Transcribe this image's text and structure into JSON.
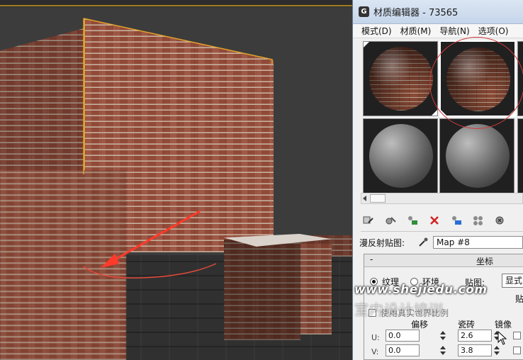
{
  "viewport": {
    "accent_color": "#e3a32a",
    "arrow_color": "#ff3a2a"
  },
  "material_editor": {
    "title": "材质编辑器 - 73565",
    "app_icon": "3ds-max-icon",
    "menu": [
      "模式(D)",
      "材质(M)",
      "导航(N)",
      "选项(O)"
    ],
    "slots": [
      {
        "type": "brick",
        "active": false
      },
      {
        "type": "brick",
        "active": true
      },
      {
        "type": "grey",
        "active": false
      },
      {
        "type": "grey",
        "active": false
      }
    ],
    "toolbar_icons": [
      "put-to-scene-icon",
      "assign-to-selection-icon",
      "make-material-copy-icon",
      "delete-icon",
      "show-map-in-viewport-icon",
      "material-id-icon",
      "pick-material-icon"
    ],
    "diffuse_label": "漫反射贴图:",
    "diffuse_map": "Map #8",
    "coords": {
      "rollout_title": "坐标",
      "radio_texture": "纹理",
      "radio_env": "环境",
      "map_label": "贴图:",
      "map_value": "显式",
      "stub_text": "贴",
      "checkbox_label": "使用真实世界比例",
      "col_offset": "偏移",
      "col_tiling": "瓷砖",
      "col_mirror": "镜像",
      "u_label": "U:",
      "v_label": "V:",
      "u_offset": "0.0",
      "v_offset": "0.0",
      "u_tiling": "2.6",
      "v_tiling": "3.8"
    },
    "highlight_color": "#d23a3a"
  },
  "watermark": {
    "url": "www.shejiedu.com",
    "cn": "室内设计培训"
  }
}
